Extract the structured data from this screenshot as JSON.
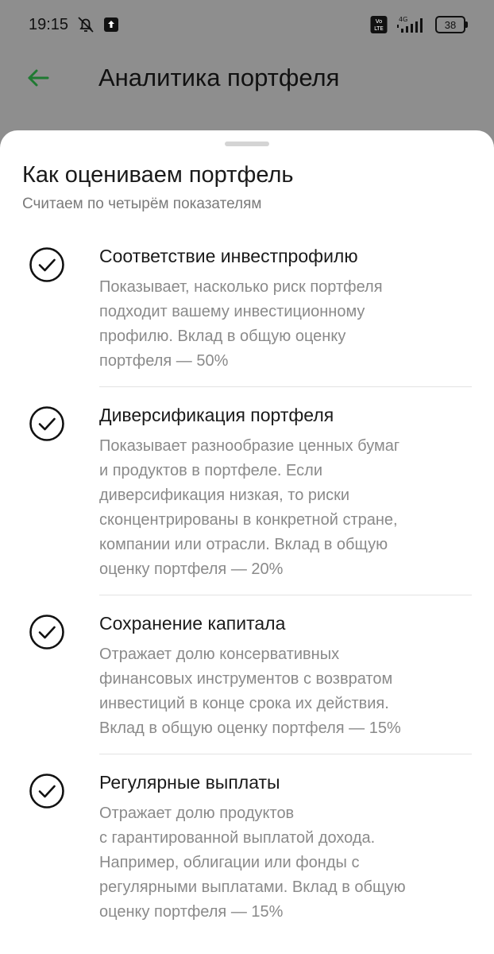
{
  "status_bar": {
    "time": "19:15",
    "icons": [
      "bell-off-icon",
      "upload-icon",
      "volte-icon",
      "signal-4g-icon"
    ],
    "battery": "38"
  },
  "app_bar": {
    "back_icon": "arrow-left-icon",
    "title": "Аналитика портфеля"
  },
  "sheet": {
    "title": "Как оцениваем портфель",
    "subtitle": "Считаем по четырём показателям",
    "criteria": [
      {
        "icon": "check-circle-icon",
        "title": "Соответствие инвестпрофилю",
        "description": "Показывает, насколько риск портфеля\nподходит вашему инвестиционному\nпрофилю. Вклад в общую оценку\nпортфеля — 50%"
      },
      {
        "icon": "check-circle-icon",
        "title": "Диверсификация портфеля",
        "description": "Показывает разнообразие ценных бумаг\nи продуктов в портфеле. Если\nдиверсификация низкая, то риски\nсконцентрированы в конкретной стране,\nкомпании или отрасли.  Вклад в общую\nоценку портфеля — 20%"
      },
      {
        "icon": "check-circle-icon",
        "title": "Сохранение капитала",
        "description": "Отражает долю консервативных\nфинансовых инструментов с возвратом\nинвестиций в конце срока их действия.\nВклад в общую оценку портфеля — 15%"
      },
      {
        "icon": "check-circle-icon",
        "title": "Регулярные выплаты",
        "description": "Отражает долю продуктов\nс гарантированной выплатой дохода.\nНапример, облигации или фонды с\nрегулярными выплатами.  Вклад в общую\nоценку портфеля — 15%"
      }
    ]
  },
  "colors": {
    "accent_green": "#21a038",
    "overlay": "#8e8e8e",
    "sheet_bg": "#ffffff",
    "secondary_text": "#8a8a8a"
  }
}
